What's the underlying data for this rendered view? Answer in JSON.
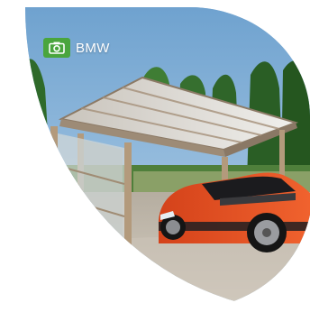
{
  "card": {
    "tag_label": "BMW",
    "tag_icon": "camera-icon",
    "tag_color": "#4aa53d"
  }
}
